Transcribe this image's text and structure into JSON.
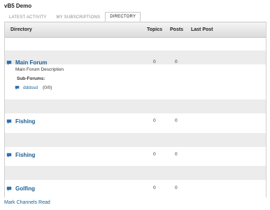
{
  "site": {
    "title": "vB5 Demo"
  },
  "tabs": [
    {
      "label": "LATEST ACTIVITY",
      "active": false
    },
    {
      "label": "MY SUBSCRIPTIONS",
      "active": false
    },
    {
      "label": "DIRECTORY",
      "active": true
    }
  ],
  "table": {
    "headers": {
      "directory": "Directory",
      "topics": "Topics",
      "posts": "Posts",
      "last_post": "Last Post"
    }
  },
  "forums": [
    {
      "title": "Main Forum",
      "description": "Main Forum Description",
      "topics": "0",
      "posts": "0",
      "subforums_label": "Sub-Forums:",
      "subforum": {
        "title": "dddssd",
        "counts": "(0/0)"
      }
    },
    {
      "title": "Fishing",
      "topics": "0",
      "posts": "0"
    },
    {
      "title": "Fishing",
      "topics": "0",
      "posts": "0"
    },
    {
      "title": "Golfing",
      "topics": "0",
      "posts": "0"
    }
  ],
  "footer": {
    "mark_read": "Mark Channels Read"
  },
  "colors": {
    "link": "#1a5d93",
    "band": "#ececec"
  },
  "icons": {
    "forum": "speech-bubble-icon"
  }
}
